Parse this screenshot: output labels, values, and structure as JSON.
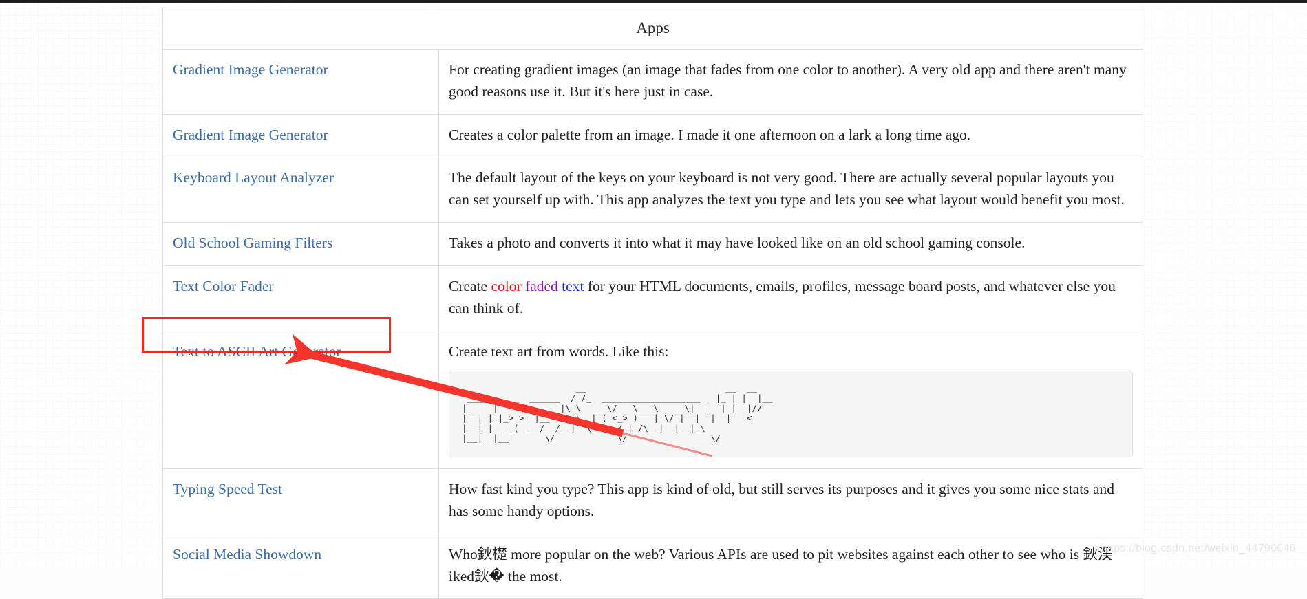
{
  "table": {
    "caption": "Apps",
    "rows": [
      {
        "name": "Gradient Image Generator",
        "description": "For creating gradient images (an image that fades from one color to another). A very old app and there aren't many good reasons use it. But it's here just in case."
      },
      {
        "name": "Gradient Image Generator",
        "description": "Creates a color palette from an image. I made it one afternoon on a lark a long time ago."
      },
      {
        "name": "Keyboard Layout Analyzer",
        "description": "The default layout of the keys on your keyboard is not very good. There are actually several popular layouts you can set yourself up with. This app analyzes the text you type and lets you see what layout would benefit you most."
      },
      {
        "name": "Old School Gaming Filters",
        "description": "Takes a photo and converts it into what it may have looked like on an old school gaming console."
      },
      {
        "name": "Text Color Fader",
        "description_parts": {
          "before": "Create ",
          "word1": "color",
          "space1": " ",
          "word2": "faded",
          "space2": " ",
          "word3": "text",
          "after": " for your HTML documents, emails, profiles, message board posts, and whatever else you can think of."
        }
      },
      {
        "name": "Text to ASCII Art Generator",
        "description": "Create text art from words. Like this:",
        "ascii_art": "                      __                           __  __\n __________  ______  / /_  ___________________   |_ | |  |__\n|_   _|  _ \\|  ____|\\ \\   __\\/ _ \\___\\   __\\|  |  | |  |//\n|  | | |_> >  |__   \\ \\  | ( <_> )   | \\/ |  |  |  |   <\n|  | |  __( ___/  /__|  \\___  /_|_/\\__|  |__|_\\\n|__|  |__|      \\/            \\/                \\/"
      },
      {
        "name": "Typing Speed Test",
        "description": "How fast kind you type? This app is kind of old, but still serves its purposes and it gives you some nice stats and has some handy options."
      },
      {
        "name": "Social Media Showdown",
        "description": "Who鈥檚 more popular on the web? Various APIs are used to pit websites against each other to see who is 鈥渓iked鈥� the most."
      }
    ]
  },
  "annotation": {
    "highlight_target": "Text to ASCII Art Generator",
    "box_color": "#ef2a22",
    "arrow_color": "#f4352c"
  },
  "watermark": {
    "text": "https://blog.csdn.net/weixin_44790046"
  }
}
